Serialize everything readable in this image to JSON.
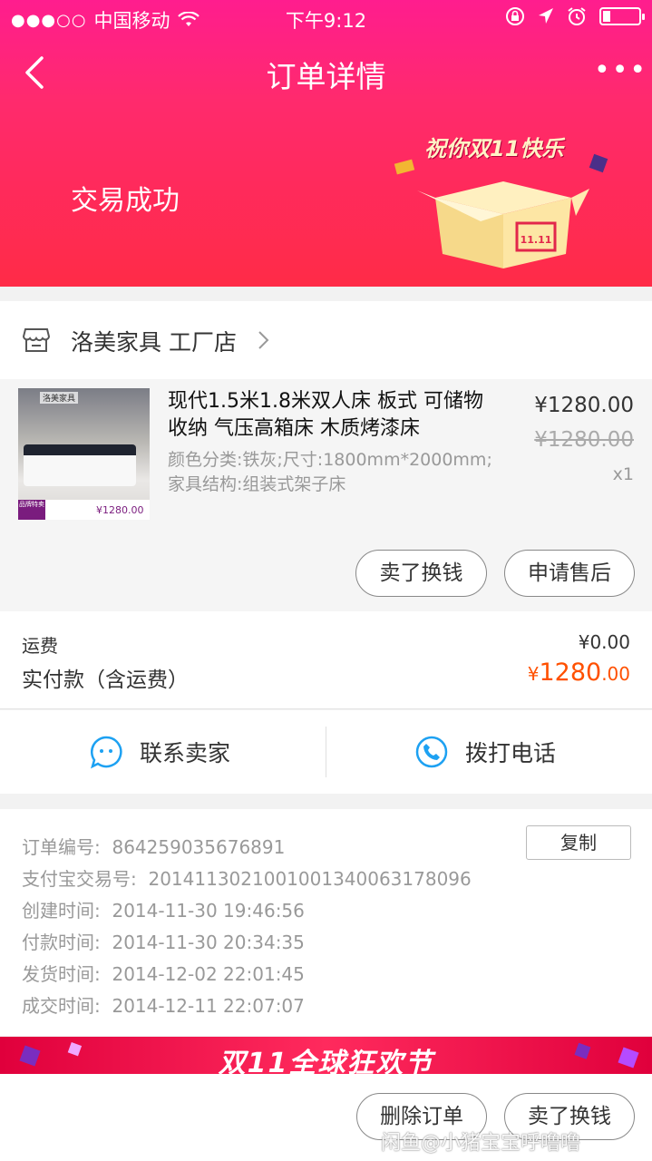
{
  "status_bar": {
    "signal": "●●●○○",
    "carrier": "中国移动",
    "time": "下午9:12"
  },
  "nav": {
    "title": "订单详情",
    "more": "•••"
  },
  "order_status": "交易成功",
  "promo_text": "祝你双11快乐",
  "promo_box_label": "11.11",
  "shop": {
    "name": "洛美家具 工厂店"
  },
  "product": {
    "title": "现代1.5米1.8米双人床 板式 可储物 收纳 气压高箱床 木质烤漆床",
    "spec": "颜色分类:铁灰;尺寸:1800mm*2000mm;家具结构:组装式架子床",
    "price": "¥1280.00",
    "original_price": "¥1280.00",
    "quantity": "x1",
    "thumb_brand": "洛美家具",
    "thumb_badge": "品牌特卖",
    "thumb_price": "¥1280.00"
  },
  "actions": {
    "sell_label": "卖了换钱",
    "after_sale_label": "申请售后",
    "delete_label": "删除订单"
  },
  "payment": {
    "shipping_label": "运费",
    "shipping_value": "¥0.00",
    "paid_label": "实付款（含运费）",
    "paid_currency": "¥",
    "paid_int": "1280",
    "paid_dec": ".00"
  },
  "contact": {
    "seller_label": "联系卖家",
    "phone_label": "拨打电话"
  },
  "order_info": {
    "copy_label": "复制",
    "rows": [
      {
        "label": "订单编号:",
        "value": "864259035676891"
      },
      {
        "label": "支付宝交易号:",
        "value": "2014113021001001340063178096"
      },
      {
        "label": "创建时间:",
        "value": "2014-11-30 19:46:56"
      },
      {
        "label": "付款时间:",
        "value": "2014-11-30 20:34:35"
      },
      {
        "label": "发货时间:",
        "value": "2014-12-02 22:01:45"
      },
      {
        "label": "成交时间:",
        "value": "2014-12-11 22:07:07"
      }
    ]
  },
  "banner_text": "双11全球狂欢节",
  "watermark": "闲鱼@小猪宝宝呼噜噜",
  "colors": {
    "header_top": "#ff1d8e",
    "header_bottom": "#ff2b47",
    "price_accent": "#ff5000",
    "contact_icon": "#1da1f2"
  },
  "icons": {
    "back": "chevron-left-icon",
    "more": "more-dots-icon",
    "shop": "store-icon",
    "seller": "chat-bubble-icon",
    "phone": "phone-icon"
  }
}
